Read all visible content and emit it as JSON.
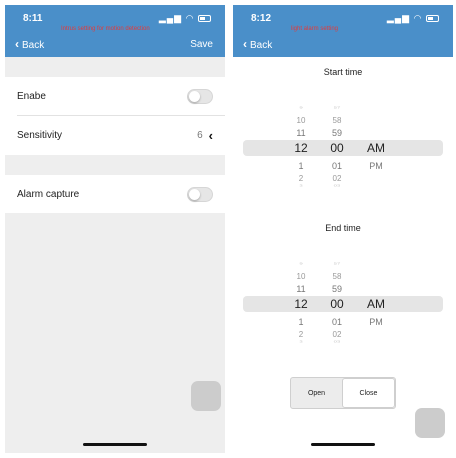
{
  "left_screen": {
    "status_time": "8:11",
    "signal_icon": "cellular-signal-icon",
    "header_note": "Intrus setting for motion detection",
    "back_label": "Back",
    "save_label": "Save",
    "rows": {
      "enable_label": "Enabe",
      "sensitivity_label": "Sensitivity",
      "sensitivity_value": "6",
      "alarm_capture_label": "Alarm capture"
    },
    "toggles": {
      "enable_on": false,
      "alarm_capture_on": false
    }
  },
  "right_screen": {
    "status_time": "8:12",
    "header_note": "light alarm setting",
    "back_label": "Back",
    "start_time_title": "Start time",
    "end_time_title": "End time",
    "picker": {
      "hours": [
        "9",
        "10",
        "11",
        "12",
        "1",
        "2",
        "3"
      ],
      "minutes": [
        "57",
        "58",
        "59",
        "00",
        "01",
        "02",
        "03"
      ],
      "ampm": [
        "AM",
        "PM"
      ],
      "selected": {
        "hour": "12",
        "minute": "00",
        "period": "AM"
      }
    },
    "segment": {
      "open_label": "Open",
      "close_label": "Close",
      "selected": "Close"
    }
  }
}
